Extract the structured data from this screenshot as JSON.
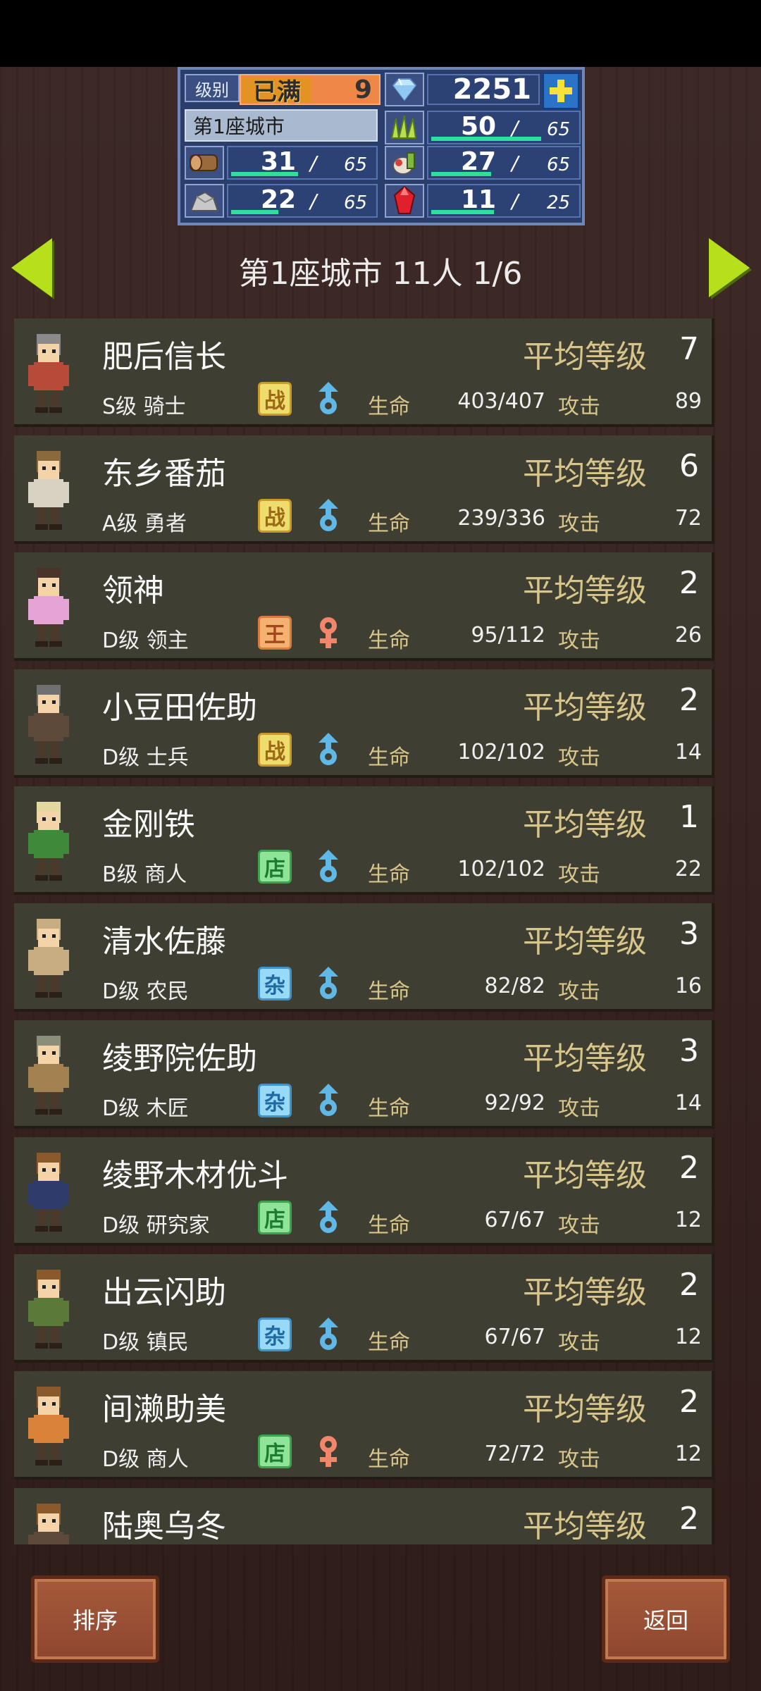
{
  "hud": {
    "level_label": "级别",
    "level_max": "已满",
    "level_value": "9",
    "gems": "2251",
    "city_name": "第1座城市",
    "resources": [
      {
        "name": "grass",
        "value": "50",
        "max": "65",
        "fill": 0.77
      },
      {
        "name": "wood",
        "value": "31",
        "max": "65",
        "fill": 0.48
      },
      {
        "name": "food",
        "value": "27",
        "max": "65",
        "fill": 0.42
      },
      {
        "name": "ore",
        "value": "22",
        "max": "65",
        "fill": 0.34
      },
      {
        "name": "ruby",
        "value": "11",
        "max": "25",
        "fill": 0.44
      }
    ]
  },
  "nav": {
    "title": "第1座城市  11人 1/6"
  },
  "labels": {
    "avg_level": "平均等级",
    "hp": "生命",
    "atk": "攻击"
  },
  "residents": [
    {
      "name": "肥后信长",
      "avg": "7",
      "rank": "S级 骑士",
      "badge": "战",
      "badge_type": "zhan",
      "gender": "male",
      "hp": "403/407",
      "atk": "89",
      "hair": "#8a8a8a",
      "cloth": "#b84a3a"
    },
    {
      "name": "东乡番茄",
      "avg": "6",
      "rank": "A级 勇者",
      "badge": "战",
      "badge_type": "zhan",
      "gender": "male",
      "hp": "239/336",
      "atk": "72",
      "hair": "#8a6a3c",
      "cloth": "#d8d2c2"
    },
    {
      "name": "领神",
      "avg": "2",
      "rank": "D级 领主",
      "badge": "王",
      "badge_type": "wang",
      "gender": "female",
      "hp": "95/112",
      "atk": "26",
      "hair": "#4a3328",
      "cloth": "#e6a4d6"
    },
    {
      "name": "小豆田佐助",
      "avg": "2",
      "rank": "D级 士兵",
      "badge": "战",
      "badge_type": "zhan",
      "gender": "male",
      "hp": "102/102",
      "atk": "14",
      "hair": "#707070",
      "cloth": "#5e4a3a"
    },
    {
      "name": "金刚铁",
      "avg": "1",
      "rank": "B级 商人",
      "badge": "店",
      "badge_type": "dian",
      "gender": "male",
      "hp": "102/102",
      "atk": "22",
      "hair": "#e3d9a0",
      "cloth": "#3e8a3a"
    },
    {
      "name": "清水佐藤",
      "avg": "3",
      "rank": "D级 农民",
      "badge": "杂",
      "badge_type": "za",
      "gender": "male",
      "hp": "82/82",
      "atk": "16",
      "hair": "#c9ad82",
      "cloth": "#c9ad82"
    },
    {
      "name": "绫野院佐助",
      "avg": "3",
      "rank": "D级 木匠",
      "badge": "杂",
      "badge_type": "za",
      "gender": "male",
      "hp": "92/92",
      "atk": "14",
      "hair": "#8b8f7a",
      "cloth": "#a38150"
    },
    {
      "name": "绫野木材优斗",
      "avg": "2",
      "rank": "D级 研究家",
      "badge": "店",
      "badge_type": "dian",
      "gender": "male",
      "hp": "67/67",
      "atk": "12",
      "hair": "#8a5a2c",
      "cloth": "#2f3b6a"
    },
    {
      "name": "出云闪助",
      "avg": "2",
      "rank": "D级 镇民",
      "badge": "杂",
      "badge_type": "za",
      "gender": "male",
      "hp": "67/67",
      "atk": "12",
      "hair": "#8a5a2c",
      "cloth": "#5b7a3a"
    },
    {
      "name": "间濑助美",
      "avg": "2",
      "rank": "D级 商人",
      "badge": "店",
      "badge_type": "dian",
      "gender": "female",
      "hp": "72/72",
      "atk": "12",
      "hair": "#8a5a2c",
      "cloth": "#d9823a"
    },
    {
      "name": "陆奥乌冬",
      "avg": "2",
      "rank": "",
      "badge": "",
      "badge_type": "",
      "gender": "",
      "hp": "",
      "atk": "",
      "hair": "#8a5a2c",
      "cloth": "#5e4a3a"
    }
  ],
  "buttons": {
    "sort": "排序",
    "back": "返回"
  },
  "colors": {
    "accent_green": "#b7e01c",
    "label_gold": "#d8c589",
    "card_bg": "#3e3e33",
    "hud_bg": "#2b3d6a"
  }
}
